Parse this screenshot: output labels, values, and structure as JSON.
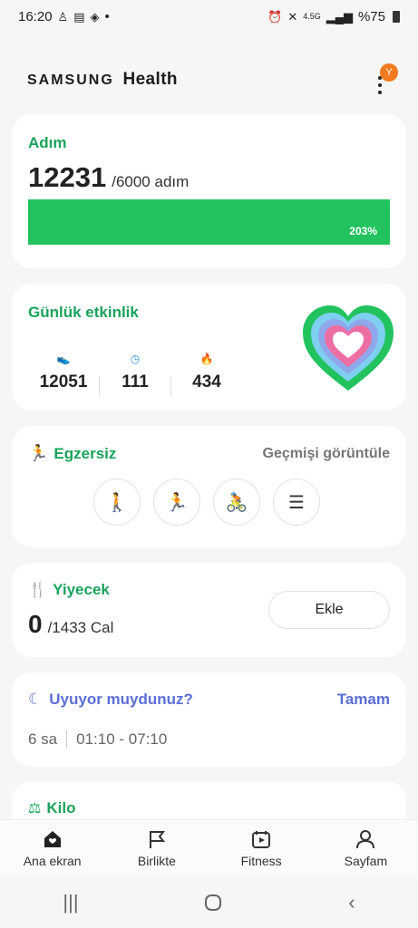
{
  "status_bar": {
    "time": "16:20",
    "dot": "•",
    "network": "4.5G",
    "battery": "%75"
  },
  "header": {
    "brand_samsung": "SAMSUNG",
    "brand_health": "Health",
    "badge": "Y"
  },
  "steps_card": {
    "title": "Adım",
    "count": "12231",
    "goal": "/6000 adım",
    "percent_label": "203%",
    "progress_fraction": 1.0
  },
  "activity_card": {
    "title": "Günlük etkinlik",
    "stats": [
      {
        "icon": "shoe-icon",
        "value": "12051",
        "color": "#1aa35a"
      },
      {
        "icon": "clock-icon",
        "value": "111",
        "color": "#2f8fe0"
      },
      {
        "icon": "flame-icon",
        "value": "434",
        "color": "#e0457a"
      }
    ]
  },
  "exercise_card": {
    "title": "Egzersiz",
    "link": "Geçmişi görüntüle",
    "buttons": [
      "walk-icon",
      "run-icon",
      "bike-icon",
      "list-icon"
    ]
  },
  "food_card": {
    "title": "Yiyecek",
    "value": "0",
    "goal": "/1433 Cal",
    "add_label": "Ekle"
  },
  "sleep_card": {
    "title": "Uyuyor muydunuz?",
    "action": "Tamam",
    "duration": "6 sa",
    "range": "01:10 - 07:10"
  },
  "weight_card": {
    "title": "Kilo"
  },
  "bottom_nav": [
    {
      "label": "Ana ekran",
      "icon": "home-icon"
    },
    {
      "label": "Birlikte",
      "icon": "flag-icon"
    },
    {
      "label": "Fitness",
      "icon": "play-calendar-icon"
    },
    {
      "label": "Sayfam",
      "icon": "person-icon"
    }
  ],
  "colors": {
    "accent_green": "#1aa35a",
    "progress_green": "#22c35e",
    "sleep_blue": "#5b6ed6"
  }
}
